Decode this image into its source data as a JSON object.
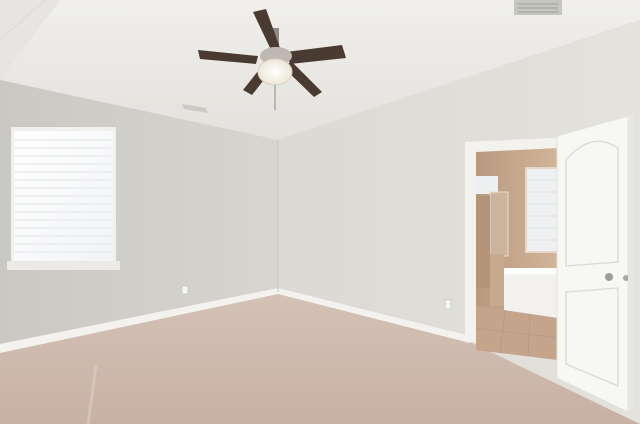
{
  "scene": {
    "kind": "photo",
    "palette": {
      "ceiling": "#e9e8e4",
      "wall_left": "#d3d2cc",
      "wall_back": "#dedcd6",
      "carpet": "#cdb9ad",
      "trim": "#f4f3ef",
      "door": "#f6f6f3",
      "fan_blade": "#4a3b32",
      "bath_tile": "#c8a68a",
      "bath_floor": "#c4a58c"
    },
    "icons": [
      "ceiling-fan-icon",
      "window-blinds-icon",
      "door-knob-icon",
      "air-vent-icon",
      "outlet-icon"
    ]
  }
}
